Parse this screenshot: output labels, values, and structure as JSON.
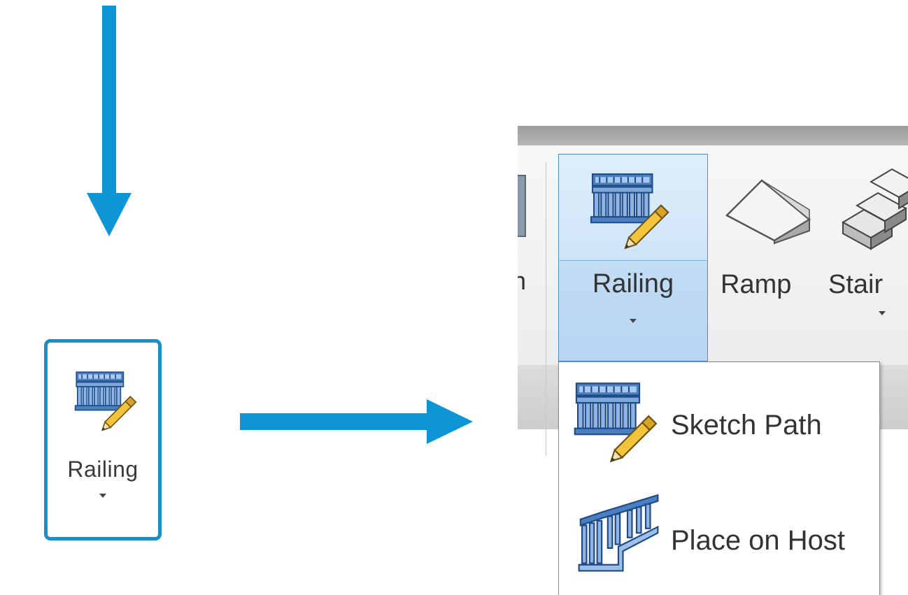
{
  "colors": {
    "arrow": "#0d95d6",
    "highlight_border": "#1b8fc9",
    "selected_bg": "#cfe5f8"
  },
  "callout": {
    "label": "Railing",
    "icon": "railing-sketch-icon"
  },
  "ribbon": {
    "prev_label_partial": "n",
    "buttons": [
      {
        "label": "Railing",
        "icon": "railing-sketch-icon",
        "has_dropdown": true,
        "selected": true
      },
      {
        "label": "Ramp",
        "icon": "ramp-icon",
        "has_dropdown": false
      },
      {
        "label": "Stair",
        "icon": "stair-icon",
        "has_dropdown": true
      }
    ]
  },
  "dropdown_menu": {
    "items": [
      {
        "label": "Sketch Path",
        "icon": "railing-sketch-icon"
      },
      {
        "label": "Place on Host",
        "icon": "railing-on-host-icon"
      }
    ]
  }
}
